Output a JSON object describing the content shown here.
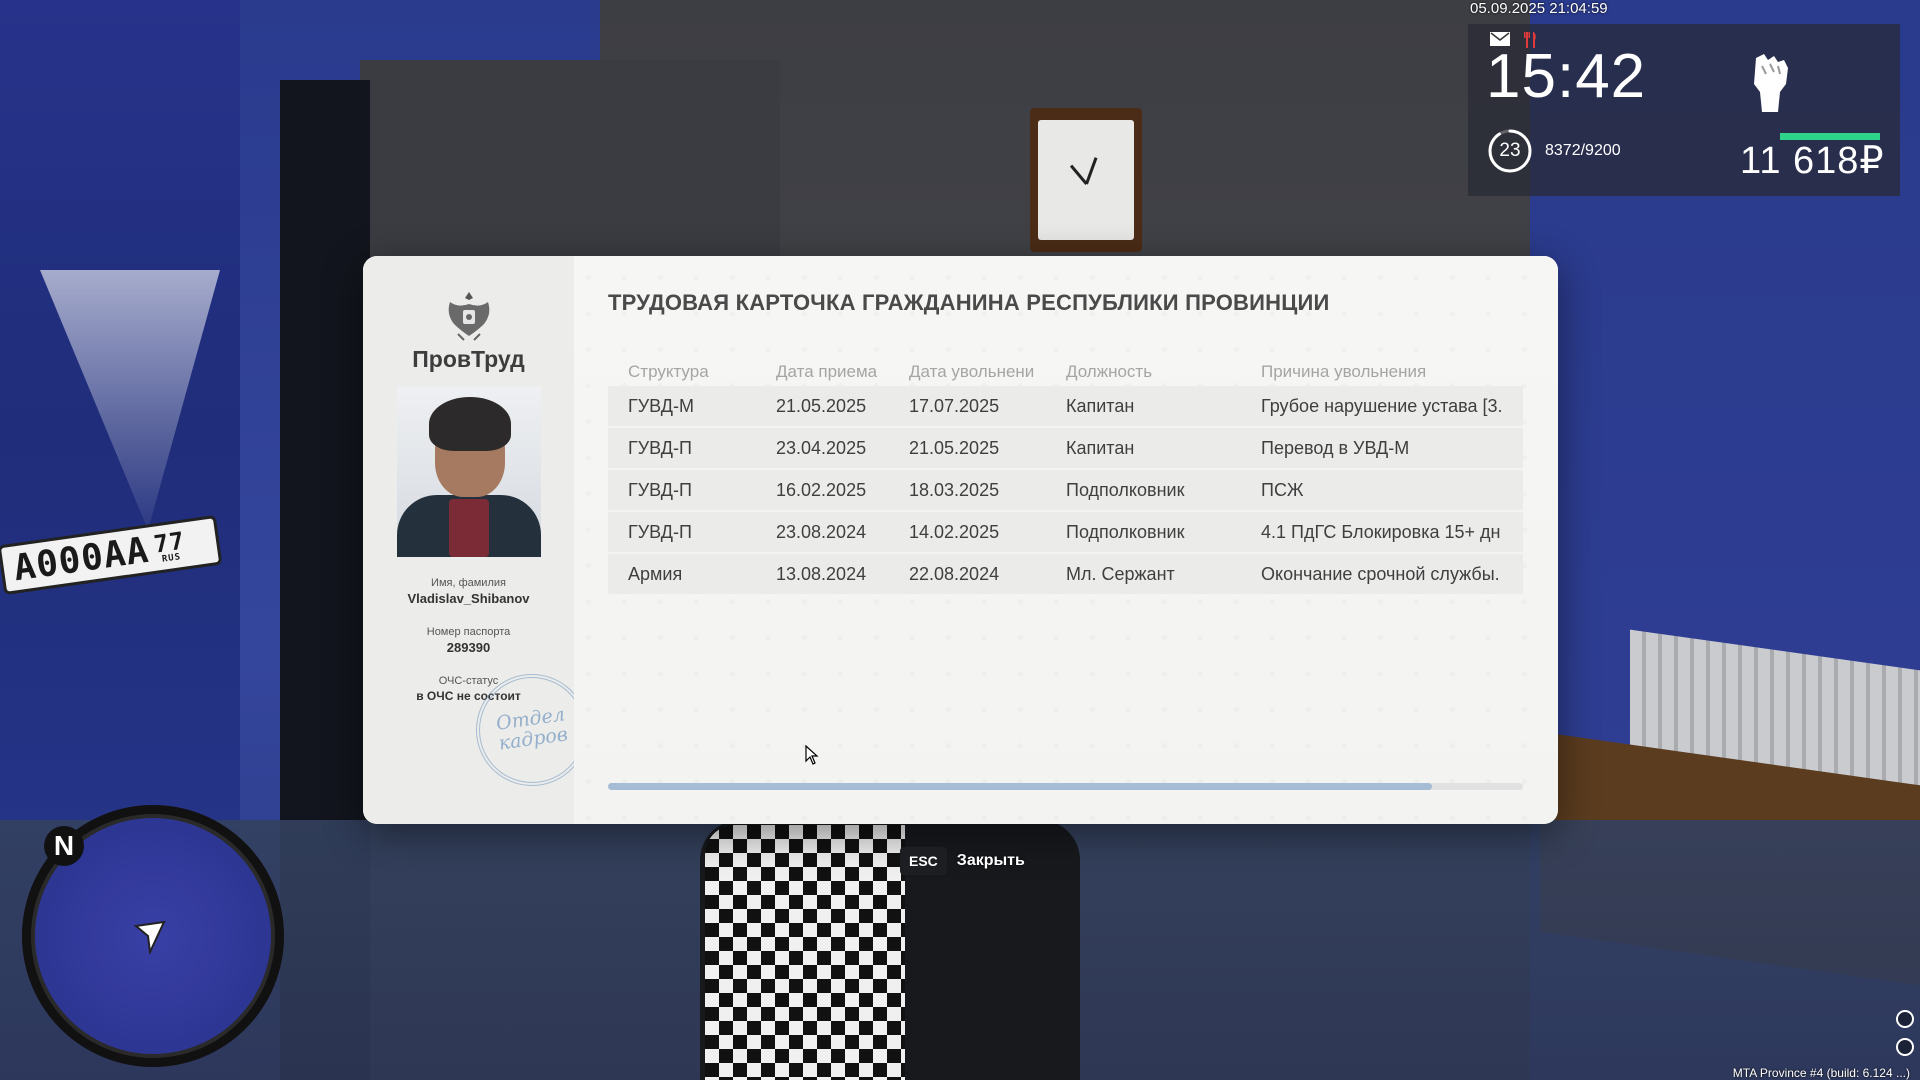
{
  "world": {
    "plate_number": "A000AA",
    "plate_region": "77",
    "plate_country": "RUS"
  },
  "hud": {
    "datetime": "05.09.2025 21:04:59",
    "time": "15:42",
    "level": "23",
    "level_progress": 0.91,
    "exp": "8372/9200",
    "money": "11 618₽",
    "health_fraction": 1.0,
    "health_color": "#2fd28a",
    "icons": [
      "mail-icon",
      "food-icon",
      "fist-icon"
    ],
    "minimap_north": "N",
    "build": "MTA Province #4 (build: 6.124 ...)"
  },
  "card": {
    "brand": "ПровТруд",
    "name_label": "Имя, фамилия",
    "name_value": "Vladislav_Shibanov",
    "passport_label": "Номер паспорта",
    "passport_value": "289390",
    "status_label": "ОЧС-статус",
    "status_value": "в ОЧС не состоит",
    "stamp_line1": "Отдел",
    "stamp_line2": "кадров",
    "title": "ТРУДОВАЯ КАРТОЧКА ГРАЖДАНИНА РЕСПУБЛИКИ ПРОВИНЦИИ",
    "columns": [
      "Структура",
      "Дата приема",
      "Дата увольнени",
      "Должность",
      "Причина увольнения"
    ],
    "rows": [
      [
        "ГУВД-М",
        "21.05.2025",
        "17.07.2025",
        "Капитан",
        "Грубое нарушение устава [3."
      ],
      [
        "ГУВД-П",
        "23.04.2025",
        "21.05.2025",
        "Капитан",
        "Перевод в УВД-М"
      ],
      [
        "ГУВД-П",
        "16.02.2025",
        "18.03.2025",
        "Подполковник",
        "ПСЖ"
      ],
      [
        "ГУВД-П",
        "23.08.2024",
        "14.02.2025",
        "Подполковник",
        "4.1 ПдГС Блокировка 15+ дн"
      ],
      [
        "Армия",
        "13.08.2024",
        "22.08.2024",
        "Мл. Сержант",
        "Окончание срочной службы."
      ]
    ],
    "scroll_fraction": 0.9,
    "accent": "#a6bcd4"
  },
  "close_hint": {
    "key": "ESC",
    "label": "Закрыть"
  }
}
